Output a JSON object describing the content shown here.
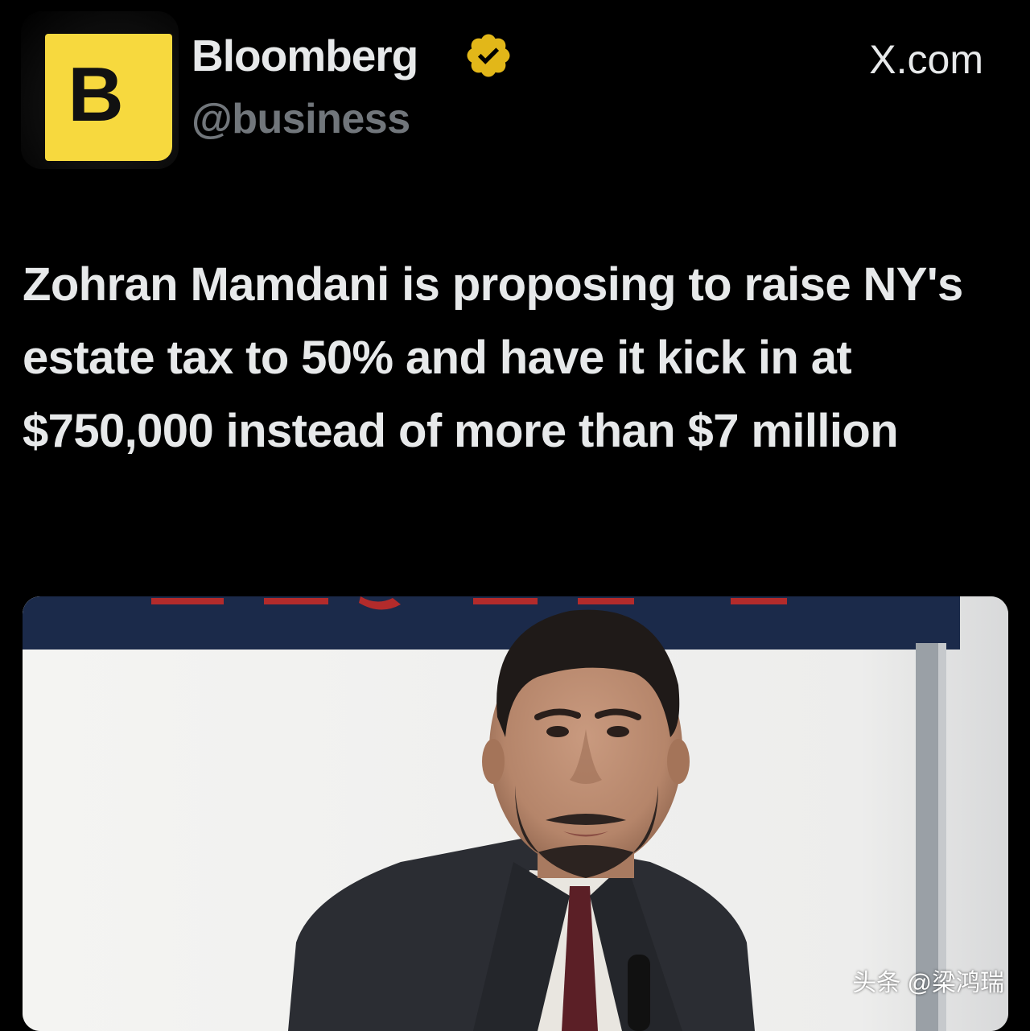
{
  "author": {
    "avatar_letter": "B",
    "display_name": "Bloomberg",
    "handle": "@business",
    "verified": true
  },
  "site_label": "X.com",
  "post": {
    "text": "Zohran Mamdani is proposing to raise NY's estate tax to 50% and have it kick in at $750,000 instead of more than $7 million"
  },
  "watermark": "头条 @梁鸿瑞",
  "colors": {
    "background": "#000000",
    "avatar_bg": "#f7d93e",
    "badge": "#e2b719",
    "text_primary": "#e7e9ea",
    "text_secondary": "#71767b"
  }
}
